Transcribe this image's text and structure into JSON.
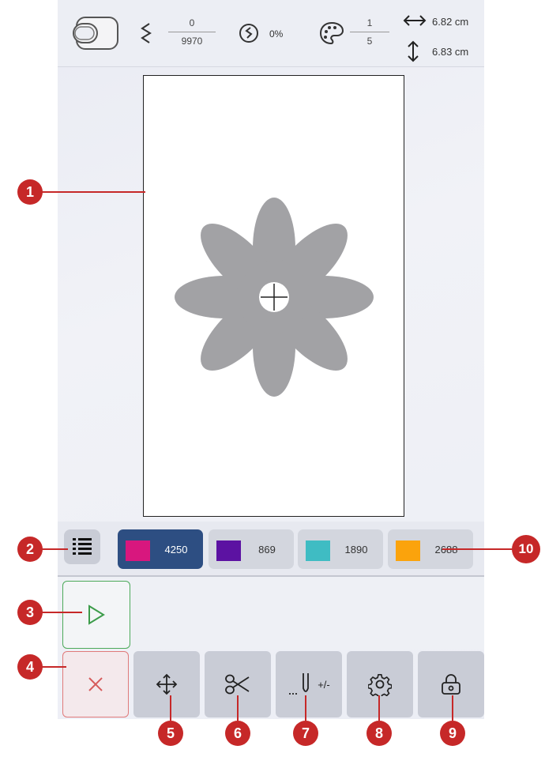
{
  "status": {
    "stitch_current": "0",
    "stitch_total": "9970",
    "progress": "0%",
    "color_current": "1",
    "color_total": "5",
    "width": "6.82 cm",
    "height": "6.83 cm",
    "icons": [
      "hoop-icon",
      "stitch-count-icon",
      "progress-icon",
      "palette-icon"
    ]
  },
  "colors": [
    {
      "value": "4250",
      "hex": "#d8177e",
      "active": true
    },
    {
      "value": "869",
      "hex": "#5c12a2",
      "active": false
    },
    {
      "value": "1890",
      "hex": "#3fbcc3",
      "active": false
    },
    {
      "value": "2688",
      "hex": "#fba30c",
      "active": false
    }
  ],
  "design": {
    "fill": "#a2a2a5",
    "shape": "flower"
  },
  "toolbar": [
    "cancel-icon",
    "move-icon",
    "scissors-icon",
    "needle-stitch-adjust-icon",
    "gear-icon",
    "lock-icon"
  ],
  "stitch_adjust_label": "+/-",
  "callouts": [
    "1",
    "2",
    "3",
    "4",
    "5",
    "6",
    "7",
    "8",
    "9",
    "10"
  ],
  "accent": {
    "callout": "#c62828",
    "active_color": "#2d4e82",
    "start": "#4caa5a",
    "cancel": "#e07a7a"
  }
}
